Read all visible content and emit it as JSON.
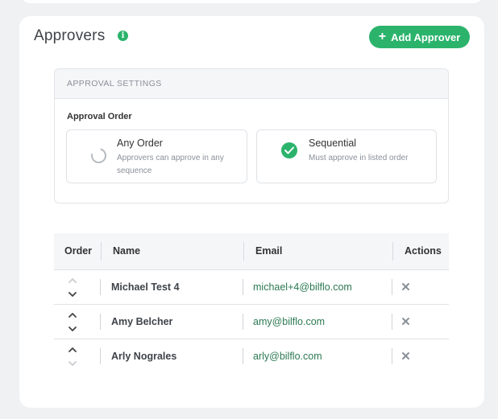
{
  "header": {
    "title": "Approvers",
    "info_icon": "i",
    "add_button": "Add Approver"
  },
  "settings": {
    "section_title": "APPROVAL SETTINGS",
    "order_label": "Approval Order",
    "options": [
      {
        "title": "Any Order",
        "desc": "Approvers can approve in any sequence",
        "selected": false
      },
      {
        "title": "Sequential",
        "desc": "Must approve in listed order",
        "selected": true
      }
    ]
  },
  "table": {
    "columns": {
      "order": "Order",
      "name": "Name",
      "email": "Email",
      "actions": "Actions"
    },
    "rows": [
      {
        "name": "Michael Test 4",
        "email": "michael+4@bilflo.com",
        "up_enabled": false,
        "down_enabled": true
      },
      {
        "name": "Amy Belcher",
        "email": "amy@bilflo.com",
        "up_enabled": true,
        "down_enabled": true
      },
      {
        "name": "Arly Nograles",
        "email": "arly@bilflo.com",
        "up_enabled": true,
        "down_enabled": false
      }
    ]
  },
  "colors": {
    "accent": "#2bb36c",
    "email_text": "#2c7a52",
    "disabled_arrow": "#c8ccd1",
    "enabled_arrow": "#444444"
  }
}
